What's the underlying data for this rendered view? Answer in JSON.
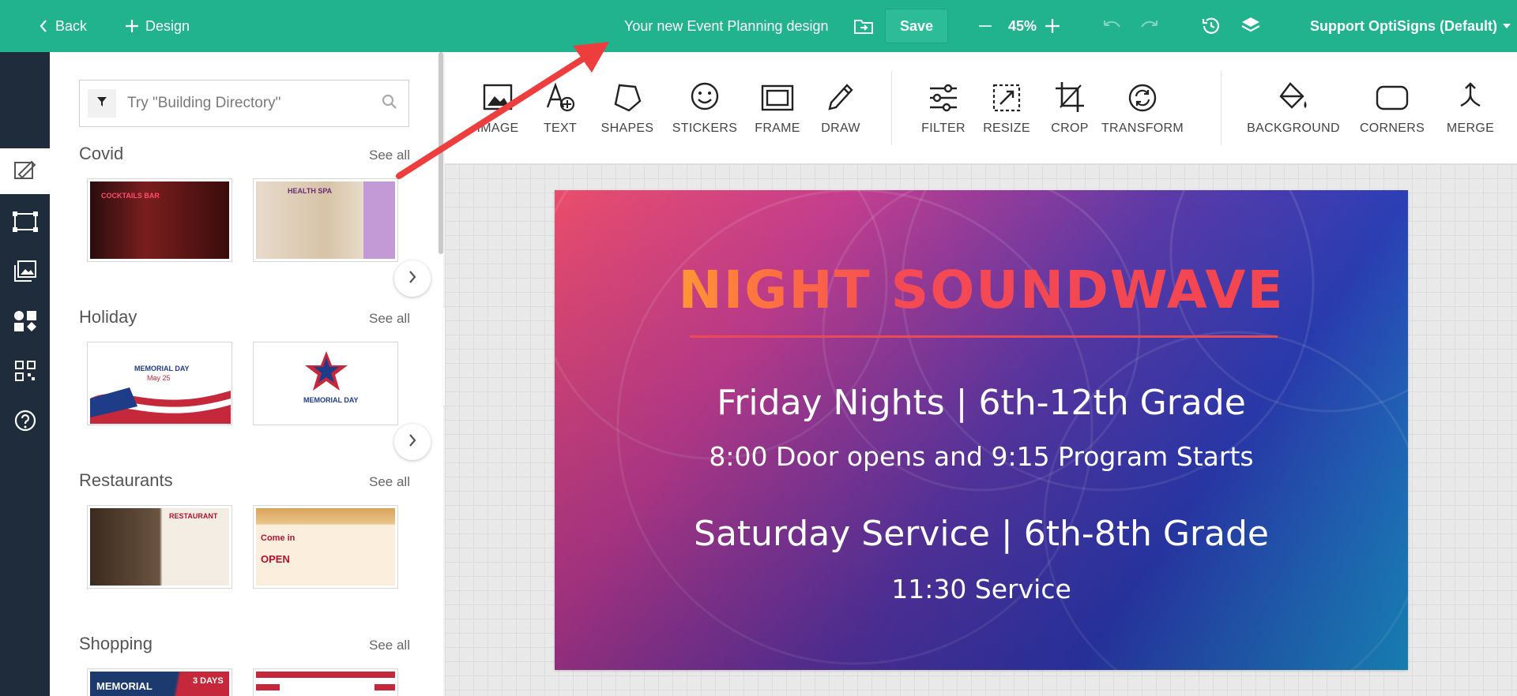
{
  "topbar": {
    "back_label": "Back",
    "design_label": "Design",
    "title": "Your new Event Planning design",
    "save_label": "Save",
    "zoom": "45%",
    "account": "Support OptiSigns (Default)"
  },
  "search": {
    "placeholder": "Try \"Building Directory\""
  },
  "categories": [
    {
      "title": "Covid",
      "see_all": "See all"
    },
    {
      "title": "Holiday",
      "see_all": "See all"
    },
    {
      "title": "Restaurants",
      "see_all": "See all"
    },
    {
      "title": "Shopping",
      "see_all": "See all"
    }
  ],
  "thumbs": {
    "covid_1": "COCKTAILS BAR",
    "covid_2": "HEALTH SPA",
    "holiday_1": "MEMORIAL DAY",
    "holiday_1_date": "May 25",
    "holiday_2": "MEMORIAL DAY",
    "rest_1": "RESTAURANT",
    "rest_2_a": "Come in",
    "rest_2_b": "OPEN",
    "shop_1": "MEMORIAL",
    "shop_1_b": "3 DAYS"
  },
  "toolbar": {
    "tools": [
      {
        "label": "IMAGE"
      },
      {
        "label": "TEXT"
      },
      {
        "label": "SHAPES"
      },
      {
        "label": "STICKERS"
      },
      {
        "label": "FRAME"
      },
      {
        "label": "DRAW"
      },
      {
        "label": "FILTER"
      },
      {
        "label": "RESIZE"
      },
      {
        "label": "CROP"
      },
      {
        "label": "TRANSFORM"
      },
      {
        "label": "BACKGROUND"
      },
      {
        "label": "CORNERS"
      },
      {
        "label": "MERGE"
      }
    ]
  },
  "artboard": {
    "title": "NIGHT SOUNDWAVE",
    "line1": "Friday Nights | 6th-12th Grade",
    "line2": "8:00 Door opens and 9:15 Program Starts",
    "line3": "Saturday Service | 6th-8th Grade",
    "line4": "11:30 Service"
  },
  "colors": {
    "topbar": "#21b28e",
    "rail": "#1f2c3c",
    "annotation_arrow": "#ee3d3d"
  }
}
